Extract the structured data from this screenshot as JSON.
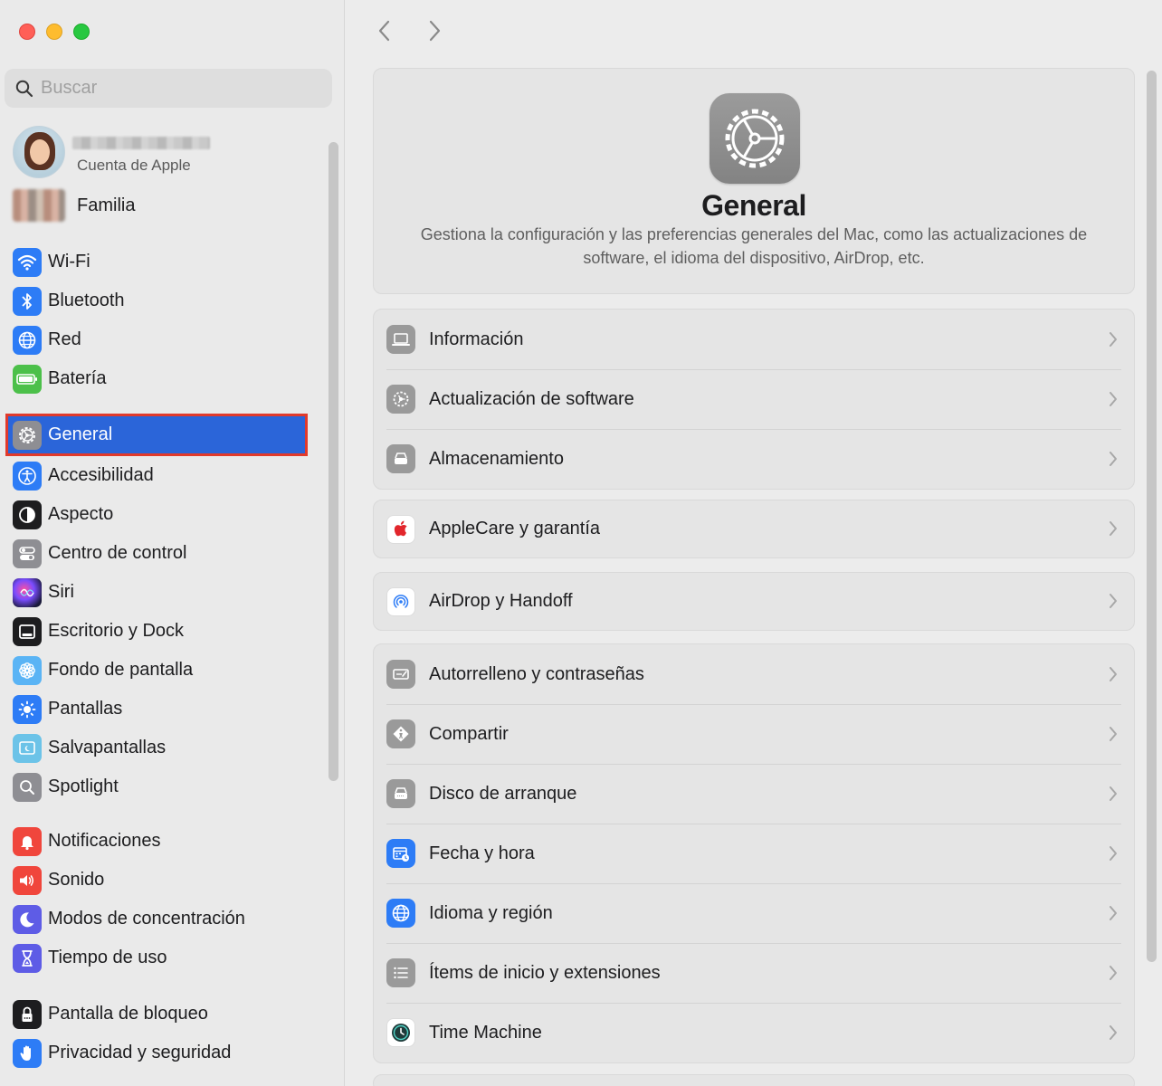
{
  "window": {
    "traffic_lights": [
      "close",
      "minimize",
      "zoom"
    ]
  },
  "search": {
    "placeholder": "Buscar"
  },
  "account": {
    "subtitle": "Cuenta de Apple"
  },
  "family": {
    "label": "Familia"
  },
  "sidebar": {
    "group1": [
      {
        "label": "Wi-Fi",
        "icon": "wifi-icon",
        "color": "#2d7cf6"
      },
      {
        "label": "Bluetooth",
        "icon": "bluetooth-icon",
        "color": "#2d7cf6"
      },
      {
        "label": "Red",
        "icon": "globe-icon",
        "color": "#2d7cf6"
      },
      {
        "label": "Batería",
        "icon": "battery-icon",
        "color": "#4cc04a"
      }
    ],
    "group2": [
      {
        "label": "General",
        "icon": "gear-icon",
        "color": "#8e8e93",
        "selected": true
      },
      {
        "label": "Accesibilidad",
        "icon": "accessibility-icon",
        "color": "#2d7cf6"
      },
      {
        "label": "Aspecto",
        "icon": "appearance-icon",
        "color": "#1d1d1f"
      },
      {
        "label": "Centro de control",
        "icon": "control-center-icon",
        "color": "#8e8e93"
      },
      {
        "label": "Siri",
        "icon": "siri-icon",
        "color": "#2a2a5a"
      },
      {
        "label": "Escritorio y Dock",
        "icon": "dock-icon",
        "color": "#1d1d1f"
      },
      {
        "label": "Fondo de pantalla",
        "icon": "wallpaper-icon",
        "color": "#5ab4f5"
      },
      {
        "label": "Pantallas",
        "icon": "display-icon",
        "color": "#2d7cf6"
      },
      {
        "label": "Salvapantallas",
        "icon": "screensaver-icon",
        "color": "#6cc3e8"
      },
      {
        "label": "Spotlight",
        "icon": "spotlight-icon",
        "color": "#8e8e93"
      }
    ],
    "group3": [
      {
        "label": "Notificaciones",
        "icon": "bell-icon",
        "color": "#f0463c"
      },
      {
        "label": "Sonido",
        "icon": "speaker-icon",
        "color": "#f0463c"
      },
      {
        "label": "Modos de concentración",
        "icon": "moon-icon",
        "color": "#5e5ce6"
      },
      {
        "label": "Tiempo de uso",
        "icon": "hourglass-icon",
        "color": "#5e5ce6"
      }
    ],
    "group4": [
      {
        "label": "Pantalla de bloqueo",
        "icon": "lock-icon",
        "color": "#1d1d1f"
      },
      {
        "label": "Privacidad y seguridad",
        "icon": "hand-icon",
        "color": "#2d7cf6"
      }
    ]
  },
  "main": {
    "hero": {
      "title": "General",
      "description": "Gestiona la configuración y las preferencias generales del Mac, como las actualizaciones de software, el idioma del dispositivo, AirDrop, etc."
    },
    "groups": [
      [
        {
          "label": "Información",
          "icon": "laptop-icon"
        },
        {
          "label": "Actualización de software",
          "icon": "software-update-icon"
        },
        {
          "label": "Almacenamiento",
          "icon": "storage-icon"
        }
      ],
      [
        {
          "label": "AppleCare y garantía",
          "icon": "apple-icon"
        }
      ],
      [
        {
          "label": "AirDrop y Handoff",
          "icon": "airdrop-icon"
        }
      ],
      [
        {
          "label": "Autorrelleno y contraseñas",
          "icon": "autofill-icon"
        },
        {
          "label": "Compartir",
          "icon": "sharing-icon"
        },
        {
          "label": "Disco de arranque",
          "icon": "startup-disk-icon"
        },
        {
          "label": "Fecha y hora",
          "icon": "calendar-clock-icon"
        },
        {
          "label": "Idioma y región",
          "icon": "globe-icon"
        },
        {
          "label": "Ítems de inicio y extensiones",
          "icon": "list-icon"
        },
        {
          "label": "Time Machine",
          "icon": "time-machine-icon"
        }
      ]
    ]
  }
}
